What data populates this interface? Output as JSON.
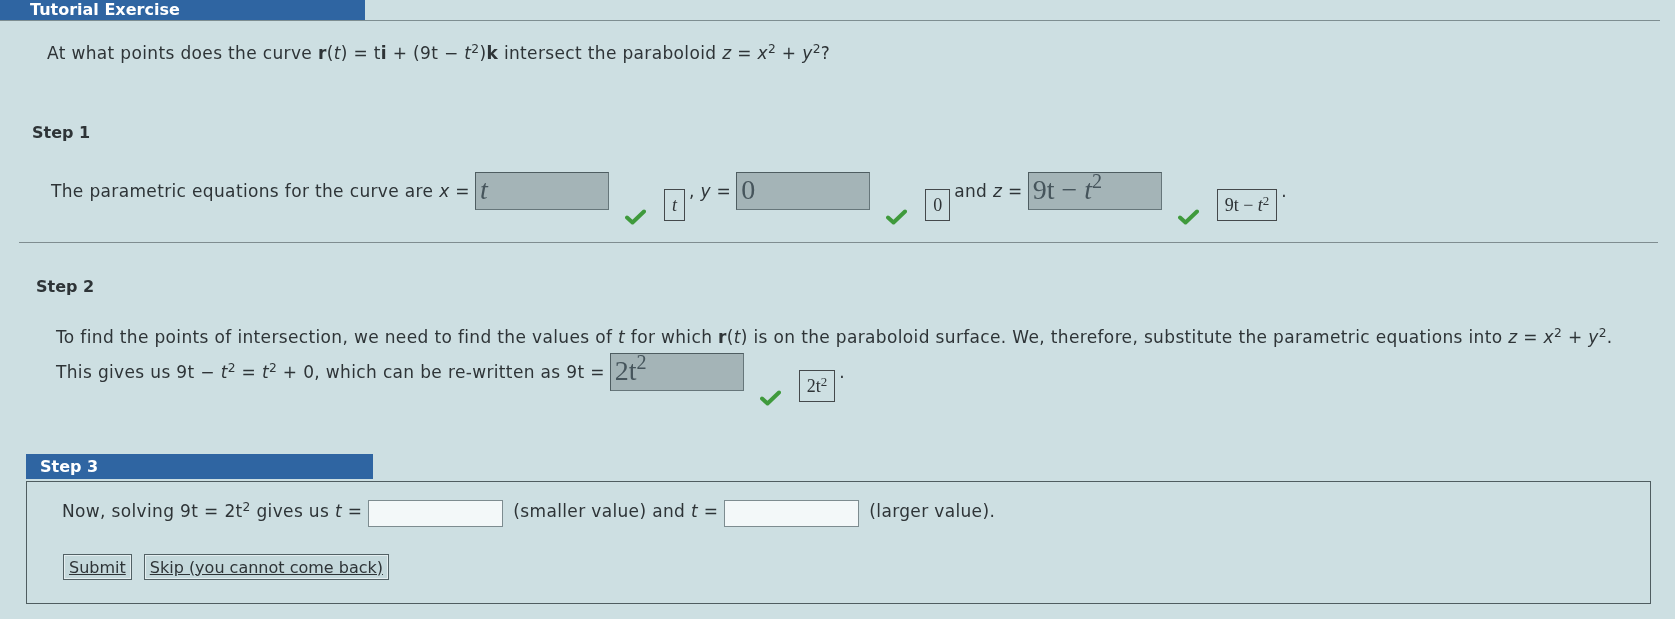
{
  "header": {
    "title": "Tutorial Exercise"
  },
  "question": "At what points does the curve **r**(*t*) = t**i** + (9t − *t*$^{2}$)**k** intersect the paraboloid *z* = *x*$^{2}$ + *y*$^{2}$?",
  "steps": [
    {
      "label": "Step 1",
      "kind": "plain",
      "lines": [
        [
          {
            "kind": "text",
            "text": "The parametric equations for the curve are *x* ="
          },
          {
            "kind": "answer",
            "value": "t",
            "italic": true,
            "correct": true,
            "key": "t"
          },
          {
            "kind": "text",
            "text": ", *y* ="
          },
          {
            "kind": "answer",
            "value": "0",
            "italic": false,
            "correct": true,
            "key": "0"
          },
          {
            "kind": "text",
            "text": "and *z* ="
          },
          {
            "kind": "answer",
            "value": "9t − *t*$^{2}$",
            "italic": false,
            "correct": true,
            "key": "9t − *t*$^{2}$"
          },
          {
            "kind": "text",
            "text": "."
          }
        ]
      ]
    },
    {
      "label": "Step 2",
      "kind": "plain",
      "lines": [
        [
          {
            "kind": "text",
            "text": "To find the points of intersection, we need to find the values of *t* for which **r**(*t*) is on the paraboloid surface. We, therefore, substitute the parametric equations into *z* = *x*$^{2}$ + *y*$^{2}$."
          }
        ],
        [
          {
            "kind": "text",
            "text": "This gives us 9t − *t*$^{2}$ = *t*$^{2}$ + 0, which can be re-written as 9t ="
          },
          {
            "kind": "answer",
            "value": "2t$^{2}$",
            "italic": false,
            "correct": true,
            "key": "2t$^{2}$"
          },
          {
            "kind": "text",
            "text": "."
          }
        ]
      ]
    },
    {
      "label": "Step 3",
      "kind": "panel",
      "lines": [
        [
          {
            "kind": "text",
            "text": "Now, solving 9t = 2t$^{2}$ gives us *t* ="
          },
          {
            "kind": "blank"
          },
          {
            "kind": "text",
            "text": "(smaller value) and *t* ="
          },
          {
            "kind": "blank"
          },
          {
            "kind": "text",
            "text": "(larger value)."
          }
        ]
      ],
      "buttons": [
        "Submit",
        "Skip (you cannot come back)"
      ]
    }
  ]
}
